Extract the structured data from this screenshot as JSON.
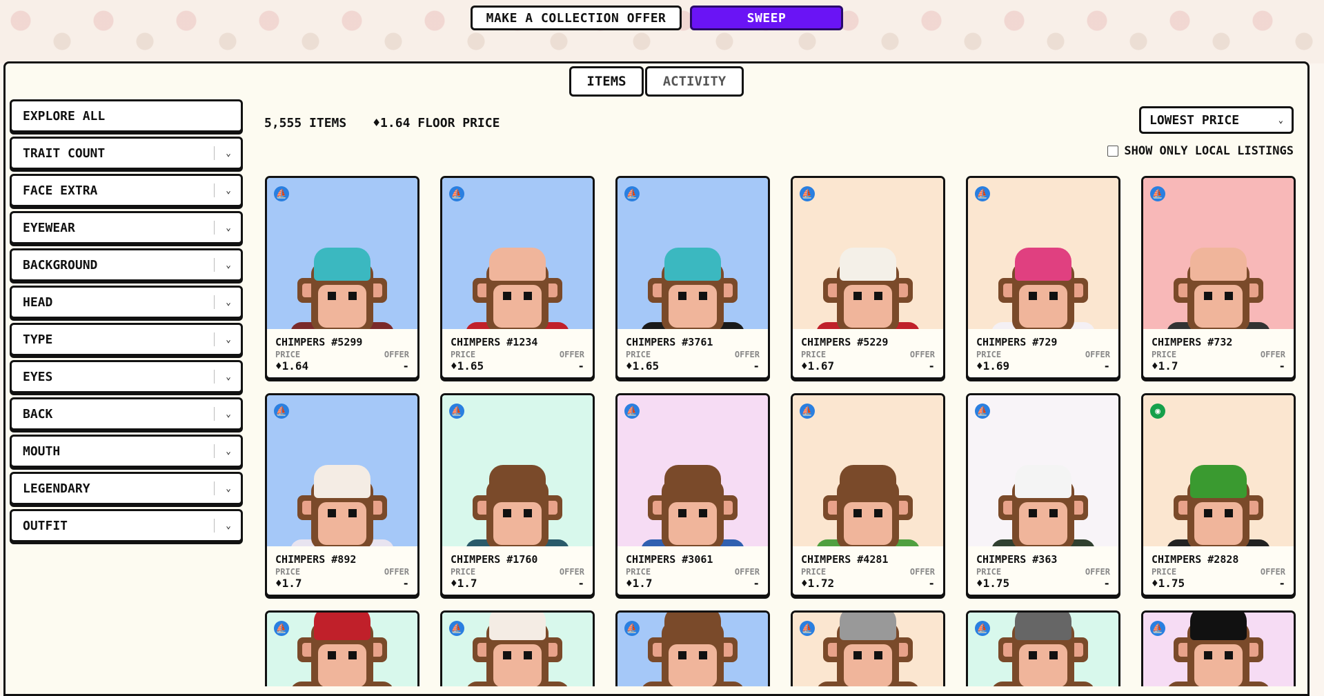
{
  "header": {
    "offer_button": "MAKE A COLLECTION OFFER",
    "sweep_button": "SWEEP"
  },
  "tabs": {
    "items": "ITEMS",
    "activity": "ACTIVITY"
  },
  "sidebar": {
    "filters": [
      "EXPLORE ALL",
      "TRAIT COUNT",
      "FACE EXTRA",
      "EYEWEAR",
      "BACKGROUND",
      "HEAD",
      "TYPE",
      "EYES",
      "BACK",
      "MOUTH",
      "LEGENDARY",
      "OUTFIT"
    ]
  },
  "summary": {
    "items_count": "5,555 ITEMS",
    "floor_price": "♦1.64 FLOOR PRICE"
  },
  "sort": {
    "selected": "LOWEST PRICE"
  },
  "local_listings": {
    "label": "SHOW ONLY LOCAL LISTINGS",
    "checked": false
  },
  "labels": {
    "price": "PRICE",
    "offer": "OFFER",
    "no_offer": "-"
  },
  "colors": {
    "accent": "#6a14f5",
    "badge_blue": "#2a7fe0",
    "badge_green": "#15a04a"
  },
  "cards": [
    {
      "name": "CHIMPERS #5299",
      "price": "♦1.64",
      "bg": "#a5c8f8",
      "hat": "#3bb8c0",
      "body": "#7a2a2a",
      "badge": "sailboat-icon"
    },
    {
      "name": "CHIMPERS #1234",
      "price": "♦1.65",
      "bg": "#a5c8f8",
      "hat": "#f0b59b",
      "body": "#c0202a",
      "badge": "sailboat-icon"
    },
    {
      "name": "CHIMPERS #3761",
      "price": "♦1.65",
      "bg": "#a5c8f8",
      "hat": "#3bb8c0",
      "body": "#1a1a1a",
      "badge": "sailboat-icon"
    },
    {
      "name": "CHIMPERS #5229",
      "price": "♦1.67",
      "bg": "#fbe6d0",
      "hat": "#f4f0e8",
      "body": "#c0202a",
      "badge": "sailboat-icon"
    },
    {
      "name": "CHIMPERS #729",
      "price": "♦1.69",
      "bg": "#fbe6d0",
      "hat": "#e04080",
      "body": "#f4f0f4",
      "badge": "sailboat-icon"
    },
    {
      "name": "CHIMPERS #732",
      "price": "♦1.7",
      "bg": "#f8b8b8",
      "hat": "#f0b59b",
      "body": "#333",
      "badge": "sailboat-icon"
    },
    {
      "name": "CHIMPERS #892",
      "price": "♦1.7",
      "bg": "#a5c8f8",
      "hat": "#f4ece4",
      "body": "#e8e4f0",
      "badge": "sailboat-icon"
    },
    {
      "name": "CHIMPERS #1760",
      "price": "♦1.7",
      "bg": "#d8f8ec",
      "hat": "#7a4a2a",
      "body": "#2a5a6a",
      "badge": "sailboat-icon"
    },
    {
      "name": "CHIMPERS #3061",
      "price": "♦1.7",
      "bg": "#f6dcf4",
      "hat": "#7a4a2a",
      "body": "#3060b0",
      "badge": "sailboat-icon"
    },
    {
      "name": "CHIMPERS #4281",
      "price": "♦1.72",
      "bg": "#fbe6d0",
      "hat": "#7a4a2a",
      "body": "#50a040",
      "badge": "sailboat-icon"
    },
    {
      "name": "CHIMPERS #363",
      "price": "♦1.75",
      "bg": "#f8f4f8",
      "hat": "#f4f4f4",
      "body": "#304030",
      "badge": "sailboat-icon"
    },
    {
      "name": "CHIMPERS #2828",
      "price": "♦1.75",
      "bg": "#fbe6d0",
      "hat": "#3a9a30",
      "body": "#222",
      "badge": "eye-icon"
    },
    {
      "name": "",
      "price": "",
      "bg": "#d8f8ec",
      "hat": "#c0202a",
      "body": "#7a4a2a",
      "badge": "sailboat-icon",
      "partial": true
    },
    {
      "name": "",
      "price": "",
      "bg": "#d8f8ec",
      "hat": "#f4ece4",
      "body": "#7a4a2a",
      "badge": "sailboat-icon",
      "partial": true
    },
    {
      "name": "",
      "price": "",
      "bg": "#a5c8f8",
      "hat": "#7a4a2a",
      "body": "#7a4a2a",
      "badge": "sailboat-icon",
      "partial": true
    },
    {
      "name": "",
      "price": "",
      "bg": "#fbe6d0",
      "hat": "#999",
      "body": "#7a4a2a",
      "badge": "sailboat-icon",
      "partial": true
    },
    {
      "name": "",
      "price": "",
      "bg": "#d8f8ec",
      "hat": "#666",
      "body": "#7a4a2a",
      "badge": "sailboat-icon",
      "partial": true
    },
    {
      "name": "",
      "price": "",
      "bg": "#f6dcf4",
      "hat": "#111",
      "body": "#7a4a2a",
      "badge": "sailboat-icon",
      "partial": true
    }
  ]
}
